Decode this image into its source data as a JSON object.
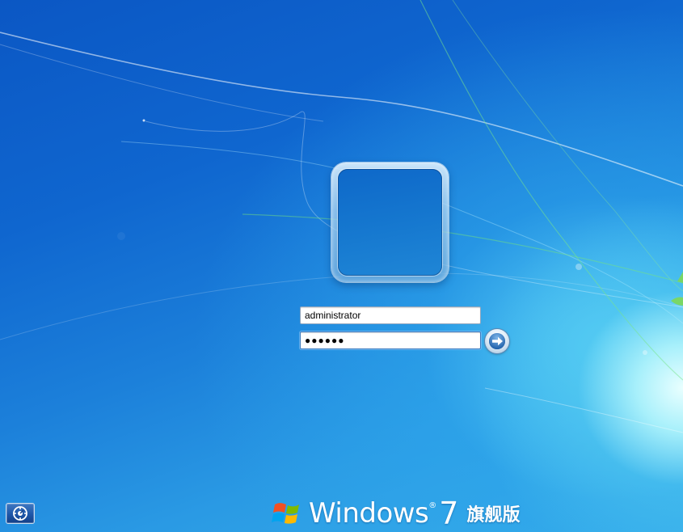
{
  "login": {
    "username": "administrator",
    "password_masked": "●●●●●●"
  },
  "branding": {
    "product": "Windows",
    "registered": "®",
    "version": "7",
    "edition": "旗舰版"
  },
  "icons": {
    "submit": "arrow-right-icon",
    "ease_of_access": "ease-of-access-icon",
    "logo": "windows-flag-icon"
  },
  "colors": {
    "background": "#1a74d4",
    "field_border_focus": "#3d7bbf",
    "flag_red": "#f25022",
    "flag_green": "#7fba00",
    "flag_blue": "#00a4ef",
    "flag_yellow": "#ffb900"
  }
}
